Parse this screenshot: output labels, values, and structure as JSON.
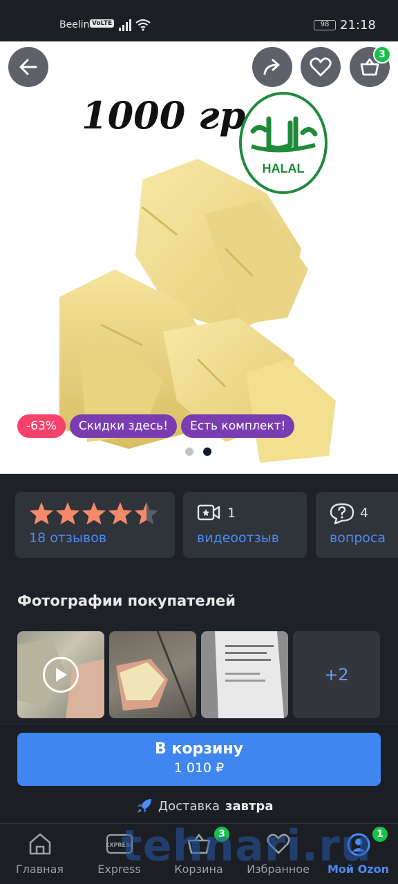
{
  "status_bar": {
    "carrier": "Beeline",
    "volte": "VoLTE",
    "battery": "98",
    "time": "21:18"
  },
  "product": {
    "weight_text": "1000 гр",
    "halal_text": "HALAL",
    "cart_count": "3",
    "badges": [
      "-63%",
      "Скидки здесь!",
      "Есть комплект!"
    ],
    "image_count": 2,
    "active_image": 2
  },
  "stats": {
    "rating": 4.5,
    "reviews_label": "18 отзывов",
    "video_count": "1",
    "video_label": "видеоотзыв",
    "questions_count": "4",
    "questions_label": "вопроса"
  },
  "photos": {
    "title": "Фотографии покупателей",
    "more_label": "+2"
  },
  "buy": {
    "button_label": "В корзину",
    "price": "1 010 ₽",
    "delivery_prefix": "Доставка",
    "delivery_day": "завтра"
  },
  "nav": {
    "items": [
      {
        "label": "Главная"
      },
      {
        "label": "Express"
      },
      {
        "label": "Корзина",
        "badge": "3"
      },
      {
        "label": "Избранное"
      },
      {
        "label": "Мой Ozon",
        "badge": "1"
      }
    ],
    "express_icon_text": "EXPRESS"
  },
  "watermark": "tehnari.ru",
  "colors": {
    "accent": "#3f86f0",
    "badge_green": "#17c14a",
    "discount": "#f5426b",
    "promo_purple": "#7a3db1",
    "star": "#f58a6a"
  }
}
